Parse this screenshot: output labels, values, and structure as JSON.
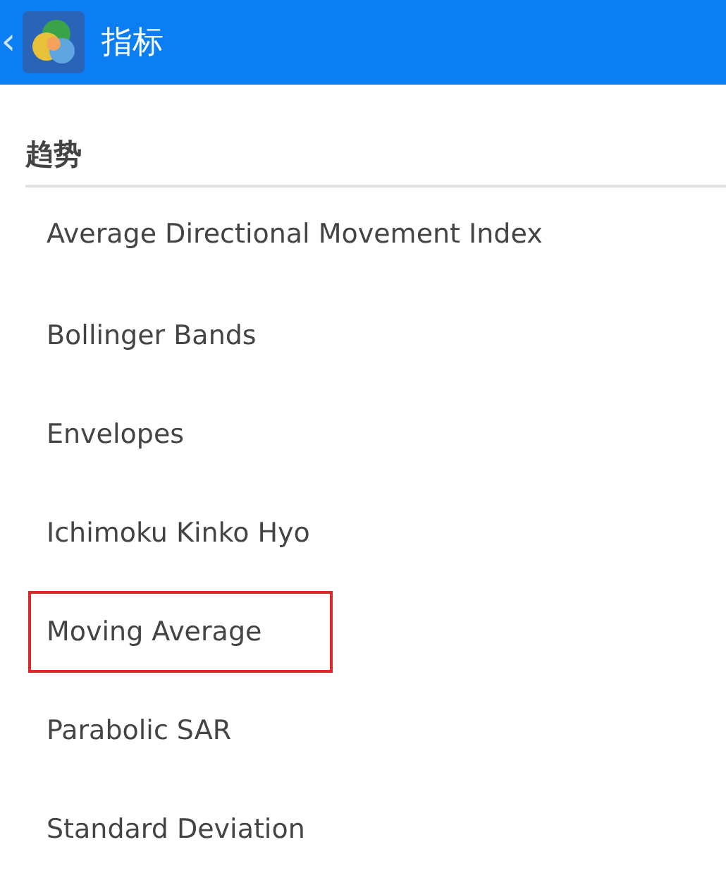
{
  "app_bar": {
    "back": "‹",
    "title": "指标"
  },
  "section": {
    "title": "趋势"
  },
  "items": [
    {
      "label": "Average Directional Movement Index",
      "highlighted": false
    },
    {
      "label": "Bollinger Bands",
      "highlighted": false
    },
    {
      "label": "Envelopes",
      "highlighted": false
    },
    {
      "label": "Ichimoku Kinko Hyo",
      "highlighted": false
    },
    {
      "label": "Moving Average",
      "highlighted": true
    },
    {
      "label": "Parabolic SAR",
      "highlighted": false
    },
    {
      "label": "Standard Deviation",
      "highlighted": false
    }
  ]
}
